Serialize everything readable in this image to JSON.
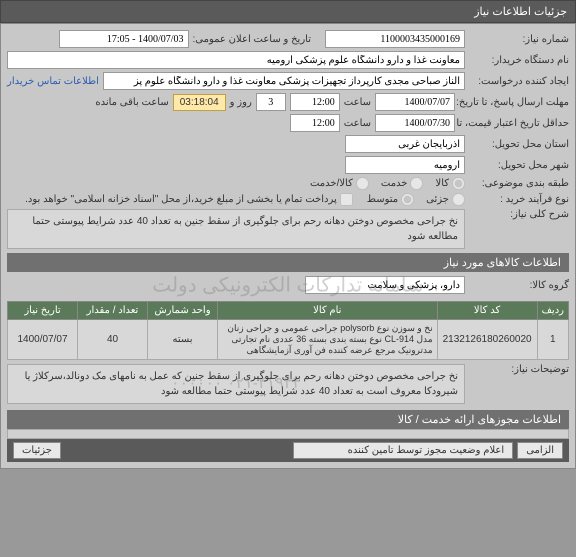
{
  "header": {
    "title": "جزئیات اطلاعات نیاز"
  },
  "fields": {
    "need_no_label": "شماره نیاز:",
    "need_no": "1100003435000169",
    "announce_label": "تاریخ و ساعت اعلان عمومی:",
    "announce_value": "1400/07/03 - 17:05",
    "buyer_label": "نام دستگاه خریدار:",
    "buyer_value": "معاونت غذا و دارو دانشگاه علوم پزشکی ارومیه",
    "creator_label": "ایجاد کننده درخواست:",
    "creator_value": "الناز صباحی مجدی کارپرداز تجهیزات پزشکی معاونت غذا و دارو دانشگاه علوم پز",
    "contact_link": "اطلاعات تماس خریدار",
    "deadline_label": "مهلت ارسال پاسخ، تا تاریخ:",
    "deadline_date": "1400/07/07",
    "time_lbl": "ساعت",
    "deadline_time": "12:00",
    "days_count": "3",
    "days_lbl": "روز و",
    "countdown": "03:18:04",
    "remaining_lbl": "ساعت باقی مانده",
    "credit_label": "حداقل تاریخ اعتبار قیمت، تا تاریخ:",
    "credit_date": "1400/07/30",
    "credit_time": "12:00",
    "province_label": "استان محل تحویل:",
    "province_value": "آذربایجان غربی",
    "city_label": "شهر محل تحویل:",
    "city_value": "ارومیه",
    "category_label": "طبقه بندی موضوعی:",
    "cat_goods": "کالا",
    "cat_service": "خدمت",
    "cat_goods_service": "کالا/خدمت",
    "process_label": "نوع فرآیند خرید :",
    "process_low": "جزئی",
    "process_mid": "متوسط",
    "payment_note": "پرداخت تمام یا بخشی از مبلغ خرید،از محل \"اسناد خزانه اسلامی\" خواهد بود.",
    "desc_label": "شرح کلی نیاز:",
    "desc_text": "نخ جراحی مخصوص دوختن دهانه رحم برای جلوگیری از سقط جنین به تعداد 40 عدد شرایط پیوستی حتما مطالعه شود"
  },
  "items_section": {
    "title": "اطلاعات کالاهای مورد نیاز",
    "group_label": "گروه کالا:",
    "group_value": "دارو، پزشکی و سلامت",
    "watermark": "سامانه تدارکات الکترونیکی دولت",
    "watermark2": "۰۲۱-۴۱۹۳۴ ۰۰۰۰۰۰",
    "columns": {
      "row": "ردیف",
      "code": "کد کالا",
      "name": "نام کالا",
      "unit": "واحد شمارش",
      "qty": "تعداد / مقدار",
      "date": "تاریخ نیاز"
    },
    "rows": [
      {
        "idx": "1",
        "code": "2132126180260020",
        "name": "نخ و سوزن نوع polysorb جراحی عمومی و جراحی زنان مدل CL-914 نوع بسته بندی بسته 36 عددی نام تجارتی مدترونیک مرجع عرضه کننده فن آوری آزمایشگاهی",
        "unit": "بسته",
        "qty": "40",
        "date": "1400/07/07"
      }
    ],
    "notes_label": "توضیحات نیاز:",
    "notes_text": "نخ جراحی مخصوص دوختن دهانه رحم برای جلوگیری از سقط جنین که عمل به نامهای مک دونالد،سرکلاژ یا شیرودکا معروف است به تعداد 40 عدد شرایط پیوستی حتما مطالعه شود"
  },
  "permits": {
    "title": "اطلاعات مجوزهای ارائه خدمت / کالا"
  },
  "footer": {
    "right_label": "الزامی",
    "left_label": "اعلام وضعیت مجوز توسط تامین کننده",
    "detail": "جزئیات"
  }
}
